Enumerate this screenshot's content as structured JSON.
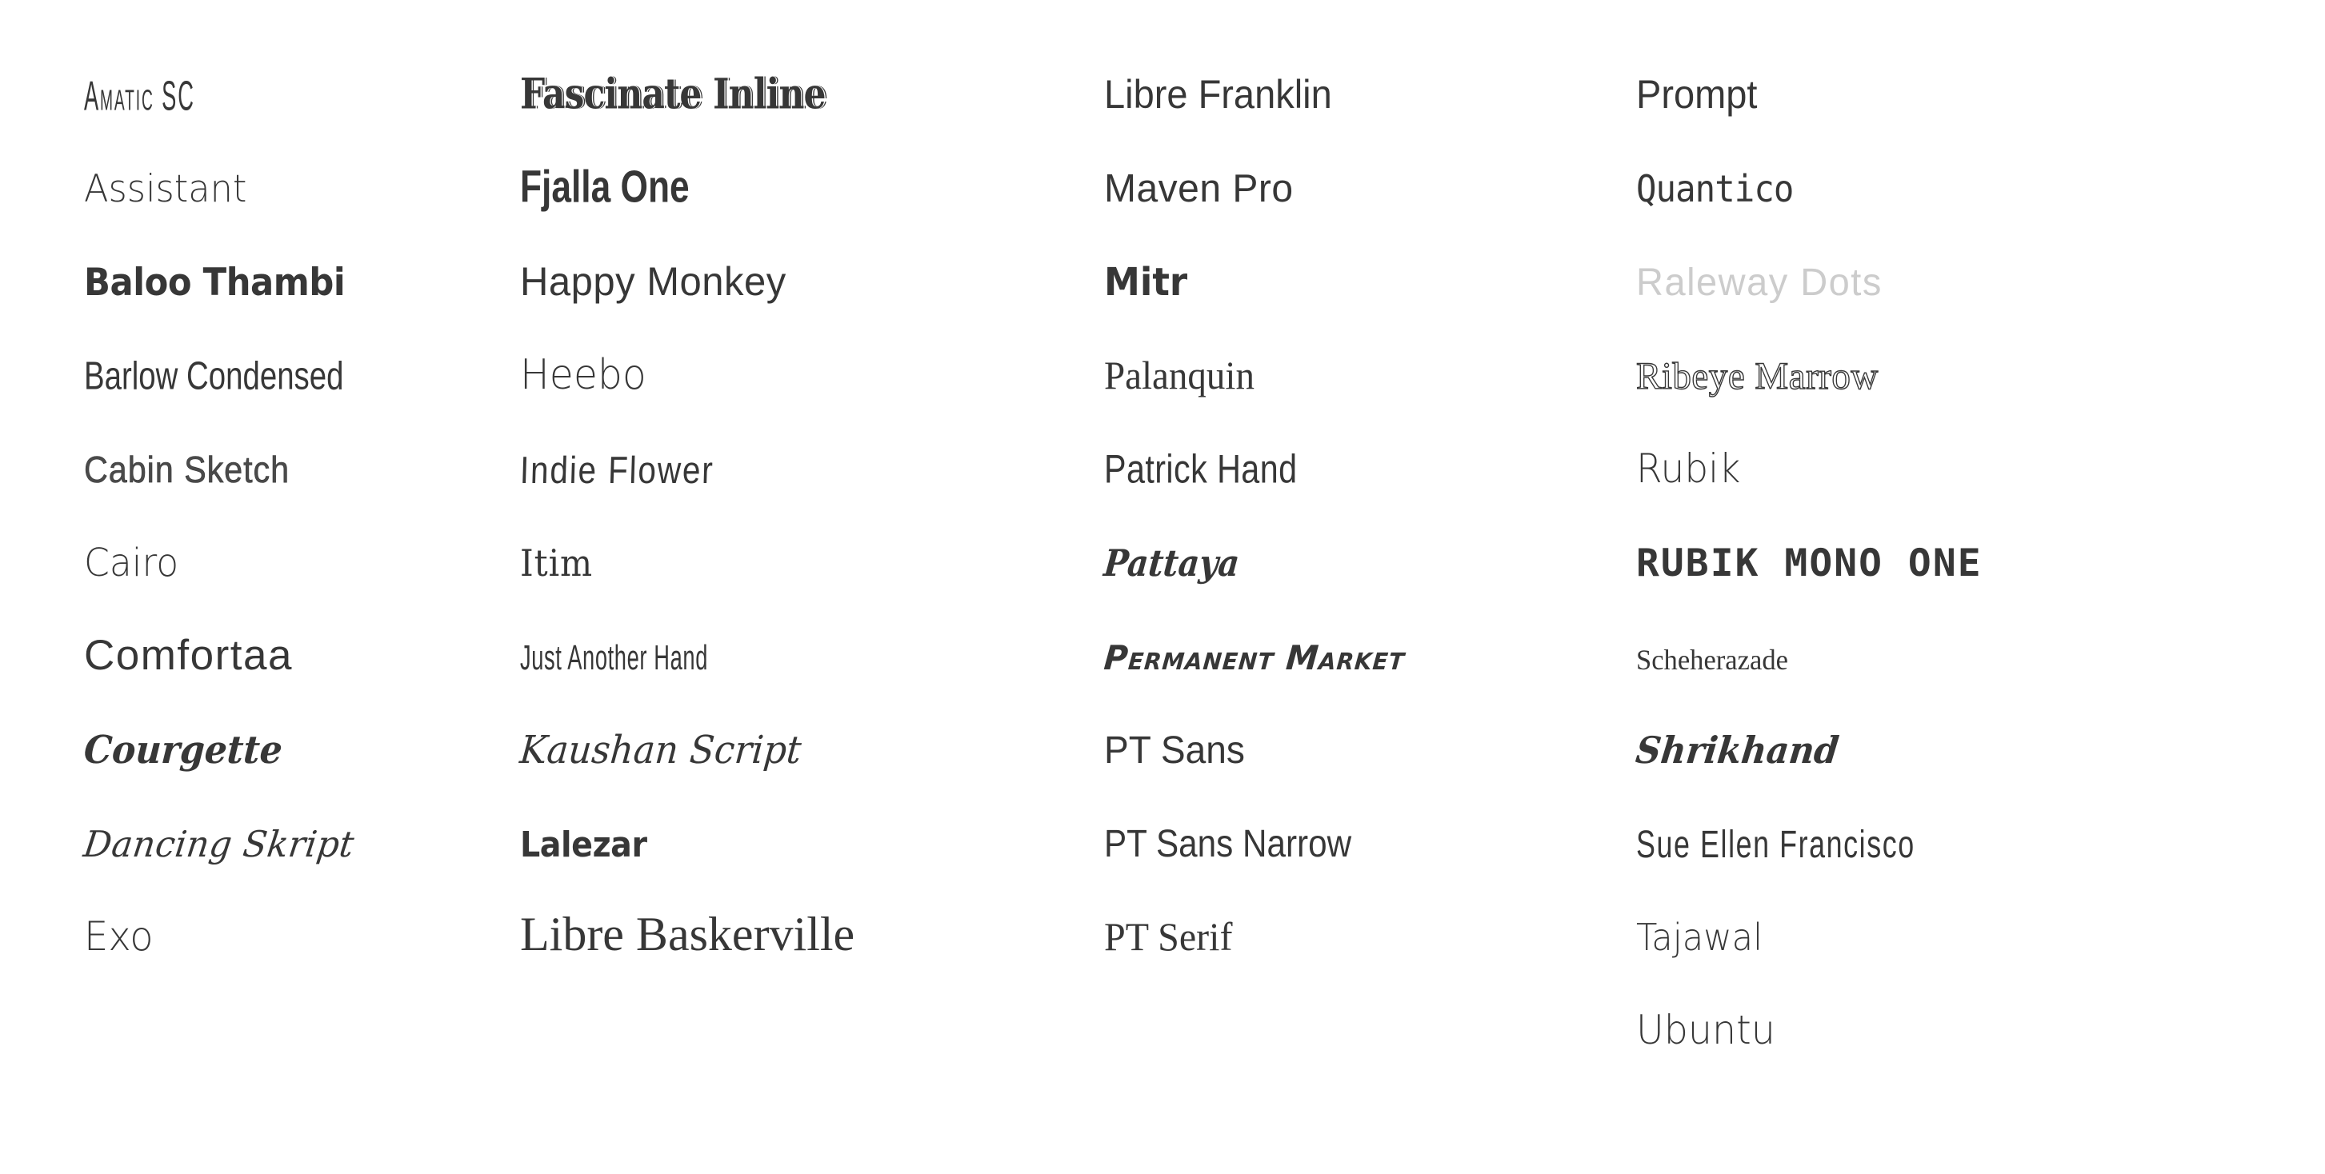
{
  "page": {
    "type": "font-specimen-list",
    "background_color": "#ffffff",
    "default_text_color": "#373737",
    "column_count": 4,
    "total_fonts": 41
  },
  "columns": [
    {
      "index": 1,
      "fonts": [
        {
          "name": "Amatic SC",
          "style_key": "f-amatic",
          "color": "#373737"
        },
        {
          "name": "Assistant",
          "style_key": "f-assistant",
          "color": "#373737"
        },
        {
          "name": "Baloo Thambi",
          "style_key": "f-baloo",
          "color": "#373737"
        },
        {
          "name": "Barlow Condensed",
          "style_key": "f-barlowcond",
          "color": "#373737"
        },
        {
          "name": "Cabin Sketch",
          "style_key": "f-cabinsk",
          "color": "#4a4a4a"
        },
        {
          "name": "Cairo",
          "style_key": "f-cairo",
          "color": "#373737"
        },
        {
          "name": "Comfortaa",
          "style_key": "f-comfortaa",
          "color": "#373737"
        },
        {
          "name": "Courgette",
          "style_key": "f-courgette",
          "color": "#373737"
        },
        {
          "name": "Dancing Skript",
          "style_key": "f-dancing",
          "color": "#373737"
        },
        {
          "name": "Exo",
          "style_key": "f-exo",
          "color": "#373737"
        }
      ]
    },
    {
      "index": 2,
      "fonts": [
        {
          "name": "Fascinate Inline",
          "style_key": "f-fascinate",
          "color": "#373737"
        },
        {
          "name": "Fjalla One",
          "style_key": "f-fjalla",
          "color": "#373737"
        },
        {
          "name": "Happy Monkey",
          "style_key": "f-happymk",
          "color": "#373737"
        },
        {
          "name": "Heebo",
          "style_key": "f-heebo",
          "color": "#373737"
        },
        {
          "name": "Indie Flower",
          "style_key": "f-indie",
          "color": "#373737"
        },
        {
          "name": "Itim",
          "style_key": "f-itim",
          "color": "#373737"
        },
        {
          "name": "Just Another Hand",
          "style_key": "f-justanot",
          "color": "#373737"
        },
        {
          "name": "Kaushan Script",
          "style_key": "f-kaushan",
          "color": "#373737"
        },
        {
          "name": "Lalezar",
          "style_key": "f-lalezar",
          "color": "#373737"
        },
        {
          "name": "Libre Baskerville",
          "style_key": "f-librebask",
          "color": "#373737"
        }
      ]
    },
    {
      "index": 3,
      "fonts": [
        {
          "name": "Libre Franklin",
          "style_key": "f-librefrank",
          "color": "#373737"
        },
        {
          "name": "Maven Pro",
          "style_key": "f-mavenpro",
          "color": "#373737"
        },
        {
          "name": "Mitr",
          "style_key": "f-mitr",
          "color": "#373737"
        },
        {
          "name": "Palanquin",
          "style_key": "f-palanquin",
          "color": "#373737"
        },
        {
          "name": "Patrick Hand",
          "style_key": "f-patrick",
          "color": "#373737"
        },
        {
          "name": "Pattaya",
          "style_key": "f-pattaya",
          "color": "#373737"
        },
        {
          "name": "Permanent Market",
          "style_key": "f-permanent",
          "color": "#373737"
        },
        {
          "name": "PT Sans",
          "style_key": "f-ptsans",
          "color": "#373737"
        },
        {
          "name": "PT Sans Narrow",
          "style_key": "f-ptsansnar",
          "color": "#373737"
        },
        {
          "name": "PT Serif",
          "style_key": "f-ptserif",
          "color": "#373737"
        }
      ]
    },
    {
      "index": 4,
      "fonts": [
        {
          "name": "Prompt",
          "style_key": "f-prompt",
          "color": "#373737"
        },
        {
          "name": "Quantico",
          "style_key": "f-quantico",
          "color": "#373737"
        },
        {
          "name": "Raleway Dots",
          "style_key": "f-ralewaydot",
          "color": "#cccccc"
        },
        {
          "name": "Ribeye Marrow",
          "style_key": "f-ribeye",
          "color": "#373737"
        },
        {
          "name": "Rubik",
          "style_key": "f-rubik",
          "color": "#373737"
        },
        {
          "name": "RUBIK MONO ONE",
          "style_key": "f-rubikmono",
          "color": "#373737"
        },
        {
          "name": "Scheherazade",
          "style_key": "f-scheher",
          "color": "#373737"
        },
        {
          "name": "Shrikhand",
          "style_key": "f-shrikhand",
          "color": "#373737"
        },
        {
          "name": "Sue Ellen Francisco",
          "style_key": "f-sueellen",
          "color": "#373737"
        },
        {
          "name": "Tajawal",
          "style_key": "f-tajawal",
          "color": "#373737"
        },
        {
          "name": "Ubuntu",
          "style_key": "f-ubuntu",
          "color": "#373737"
        }
      ]
    }
  ]
}
